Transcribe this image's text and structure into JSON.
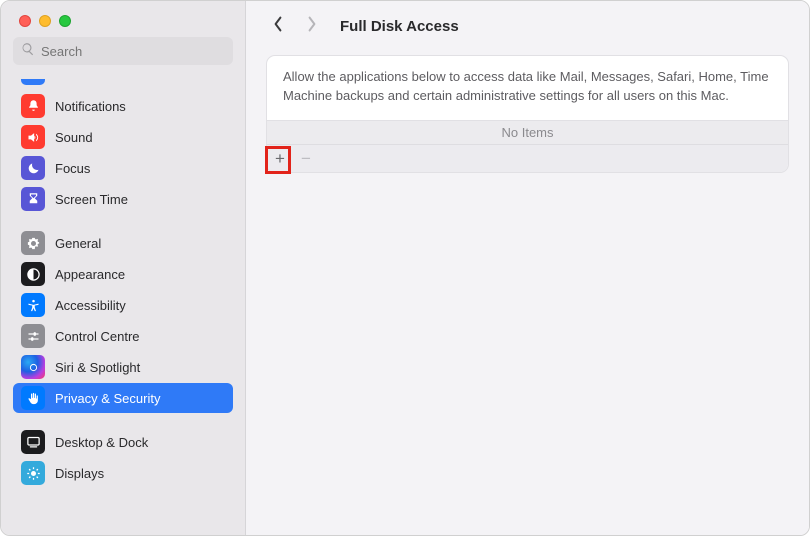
{
  "search": {
    "placeholder": "Search"
  },
  "sidebar": {
    "items": [
      {
        "label": "Notifications"
      },
      {
        "label": "Sound"
      },
      {
        "label": "Focus"
      },
      {
        "label": "Screen Time"
      },
      {
        "label": "General"
      },
      {
        "label": "Appearance"
      },
      {
        "label": "Accessibility"
      },
      {
        "label": "Control Centre"
      },
      {
        "label": "Siri & Spotlight"
      },
      {
        "label": "Privacy & Security"
      },
      {
        "label": "Desktop & Dock"
      },
      {
        "label": "Displays"
      }
    ]
  },
  "main": {
    "title": "Full Disk Access",
    "description": "Allow the applications below to access data like Mail, Messages, Safari, Home, Time Machine backups and certain administrative settings for all users on this Mac.",
    "empty_label": "No Items",
    "add_symbol": "+",
    "remove_symbol": "−"
  }
}
